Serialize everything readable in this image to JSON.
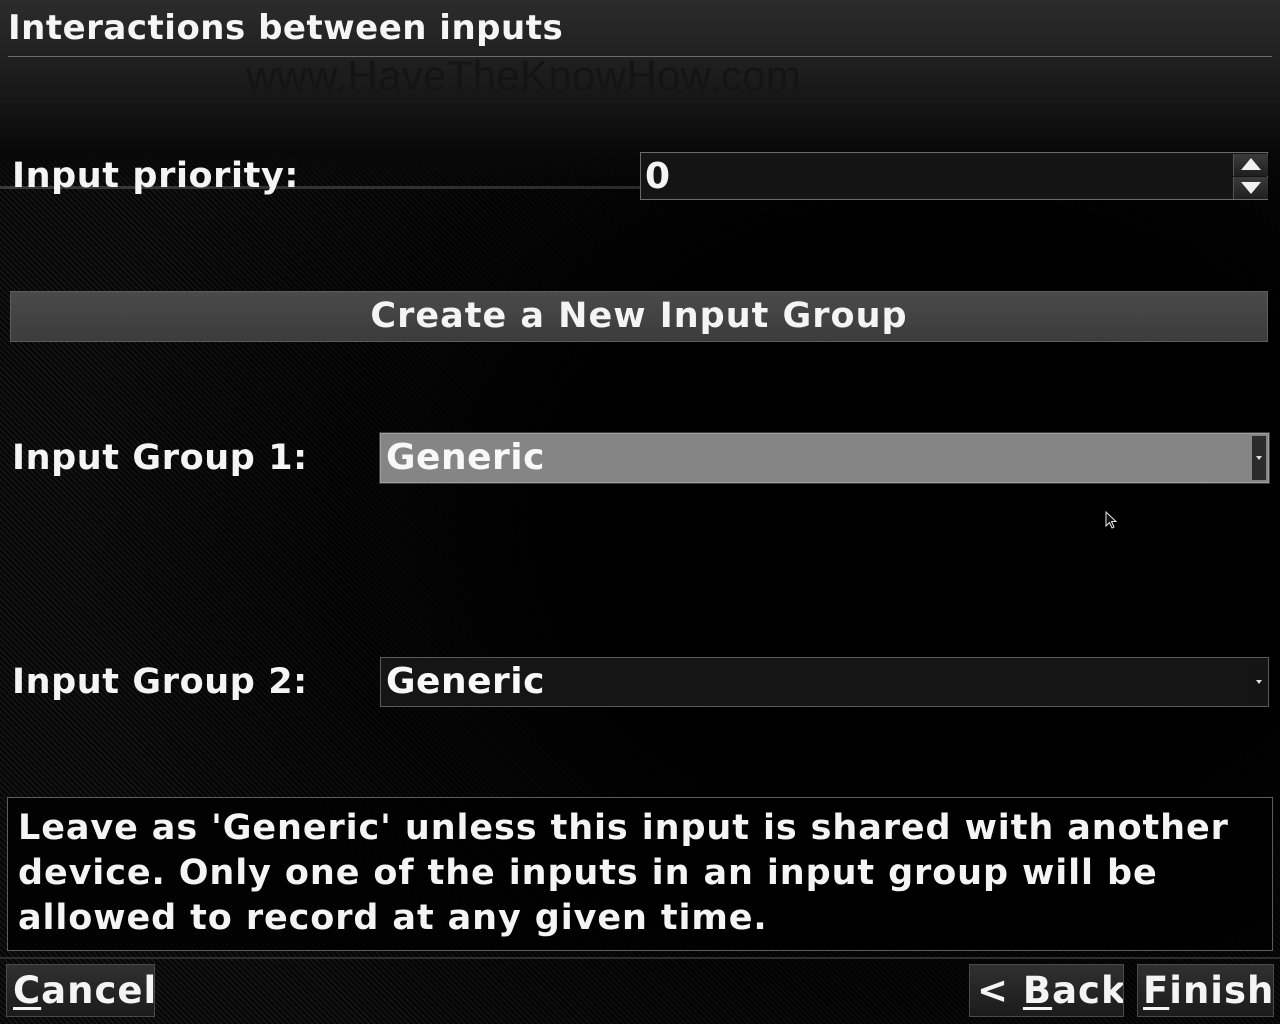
{
  "window": {
    "title": "Interactions between inputs",
    "watermark": "www.HaveTheKnowHow.com"
  },
  "priority": {
    "label": "Input priority:",
    "value": "0"
  },
  "create_group_button": {
    "label": "Create a New Input Group"
  },
  "group1": {
    "label": "Input Group 1:",
    "selected": "Generic"
  },
  "group2": {
    "label": "Input Group 2:",
    "selected": "Generic"
  },
  "help_text": "Leave as 'Generic' unless this input is shared with another device. Only one of the inputs in an input group will be allowed to record at any given time.",
  "footer": {
    "cancel": {
      "mnemonic": "C",
      "rest": "ancel"
    },
    "back": {
      "prefix": "< ",
      "mnemonic": "B",
      "rest": "ack"
    },
    "finish": {
      "mnemonic": "F",
      "rest": "inish"
    }
  },
  "icons": {
    "spin_up": "arrow-up-icon",
    "spin_down": "arrow-down-icon",
    "dropdown": "chevron-down-icon",
    "pointer": "mouse-pointer-icon"
  },
  "colors": {
    "background": "#000000",
    "text": "#f4f4f4",
    "selected_combo": "#858585",
    "button": "#444444"
  }
}
